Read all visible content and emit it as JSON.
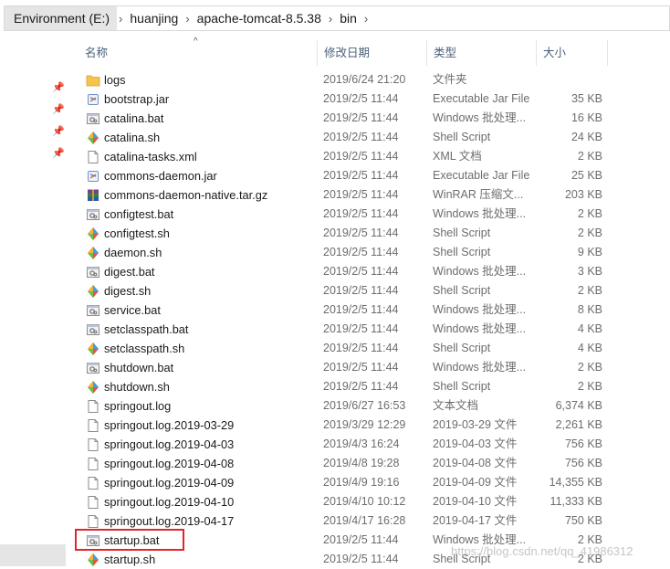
{
  "breadcrumb": {
    "items": [
      "Environment (E:)",
      "huanjing",
      "apache-tomcat-8.5.38",
      "bin"
    ],
    "separator": "›"
  },
  "columns": {
    "name": "名称",
    "date": "修改日期",
    "type": "类型",
    "size": "大小"
  },
  "files": [
    {
      "name": "logs",
      "date": "2019/6/24 21:20",
      "type": "文件夹",
      "size": "",
      "icon": "folder-icon"
    },
    {
      "name": "bootstrap.jar",
      "date": "2019/2/5 11:44",
      "type": "Executable Jar File",
      "size": "35 KB",
      "icon": "jar-icon"
    },
    {
      "name": "catalina.bat",
      "date": "2019/2/5 11:44",
      "type": "Windows 批处理...",
      "size": "16 KB",
      "icon": "bat-icon"
    },
    {
      "name": "catalina.sh",
      "date": "2019/2/5 11:44",
      "type": "Shell Script",
      "size": "24 KB",
      "icon": "sh-icon"
    },
    {
      "name": "catalina-tasks.xml",
      "date": "2019/2/5 11:44",
      "type": "XML 文档",
      "size": "2 KB",
      "icon": "document-icon"
    },
    {
      "name": "commons-daemon.jar",
      "date": "2019/2/5 11:44",
      "type": "Executable Jar File",
      "size": "25 KB",
      "icon": "jar-icon"
    },
    {
      "name": "commons-daemon-native.tar.gz",
      "date": "2019/2/5 11:44",
      "type": "WinRAR 压缩文...",
      "size": "203 KB",
      "icon": "archive-icon"
    },
    {
      "name": "configtest.bat",
      "date": "2019/2/5 11:44",
      "type": "Windows 批处理...",
      "size": "2 KB",
      "icon": "bat-icon"
    },
    {
      "name": "configtest.sh",
      "date": "2019/2/5 11:44",
      "type": "Shell Script",
      "size": "2 KB",
      "icon": "sh-icon"
    },
    {
      "name": "daemon.sh",
      "date": "2019/2/5 11:44",
      "type": "Shell Script",
      "size": "9 KB",
      "icon": "sh-icon"
    },
    {
      "name": "digest.bat",
      "date": "2019/2/5 11:44",
      "type": "Windows 批处理...",
      "size": "3 KB",
      "icon": "bat-icon"
    },
    {
      "name": "digest.sh",
      "date": "2019/2/5 11:44",
      "type": "Shell Script",
      "size": "2 KB",
      "icon": "sh-icon"
    },
    {
      "name": "service.bat",
      "date": "2019/2/5 11:44",
      "type": "Windows 批处理...",
      "size": "8 KB",
      "icon": "bat-icon"
    },
    {
      "name": "setclasspath.bat",
      "date": "2019/2/5 11:44",
      "type": "Windows 批处理...",
      "size": "4 KB",
      "icon": "bat-icon"
    },
    {
      "name": "setclasspath.sh",
      "date": "2019/2/5 11:44",
      "type": "Shell Script",
      "size": "4 KB",
      "icon": "sh-icon"
    },
    {
      "name": "shutdown.bat",
      "date": "2019/2/5 11:44",
      "type": "Windows 批处理...",
      "size": "2 KB",
      "icon": "bat-icon"
    },
    {
      "name": "shutdown.sh",
      "date": "2019/2/5 11:44",
      "type": "Shell Script",
      "size": "2 KB",
      "icon": "sh-icon"
    },
    {
      "name": "springout.log",
      "date": "2019/6/27 16:53",
      "type": "文本文档",
      "size": "6,374 KB",
      "icon": "document-icon"
    },
    {
      "name": "springout.log.2019-03-29",
      "date": "2019/3/29 12:29",
      "type": "2019-03-29 文件",
      "size": "2,261 KB",
      "icon": "document-icon"
    },
    {
      "name": "springout.log.2019-04-03",
      "date": "2019/4/3 16:24",
      "type": "2019-04-03 文件",
      "size": "756 KB",
      "icon": "document-icon"
    },
    {
      "name": "springout.log.2019-04-08",
      "date": "2019/4/8 19:28",
      "type": "2019-04-08 文件",
      "size": "756 KB",
      "icon": "document-icon"
    },
    {
      "name": "springout.log.2019-04-09",
      "date": "2019/4/9 19:16",
      "type": "2019-04-09 文件",
      "size": "14,355 KB",
      "icon": "document-icon"
    },
    {
      "name": "springout.log.2019-04-10",
      "date": "2019/4/10 10:12",
      "type": "2019-04-10 文件",
      "size": "11,333 KB",
      "icon": "document-icon"
    },
    {
      "name": "springout.log.2019-04-17",
      "date": "2019/4/17 16:28",
      "type": "2019-04-17 文件",
      "size": "750 KB",
      "icon": "document-icon"
    },
    {
      "name": "startup.bat",
      "date": "2019/2/5 11:44",
      "type": "Windows 批处理...",
      "size": "2 KB",
      "icon": "bat-icon"
    },
    {
      "name": "startup.sh",
      "date": "2019/2/5 11:44",
      "type": "Shell Script",
      "size": "2 KB",
      "icon": "sh-icon"
    }
  ],
  "watermark": "https://blog.csdn.net/qq_41986312",
  "colors": {
    "highlight": "#e0262b",
    "header_text": "#4c607a",
    "folder": "#f5c34e"
  }
}
